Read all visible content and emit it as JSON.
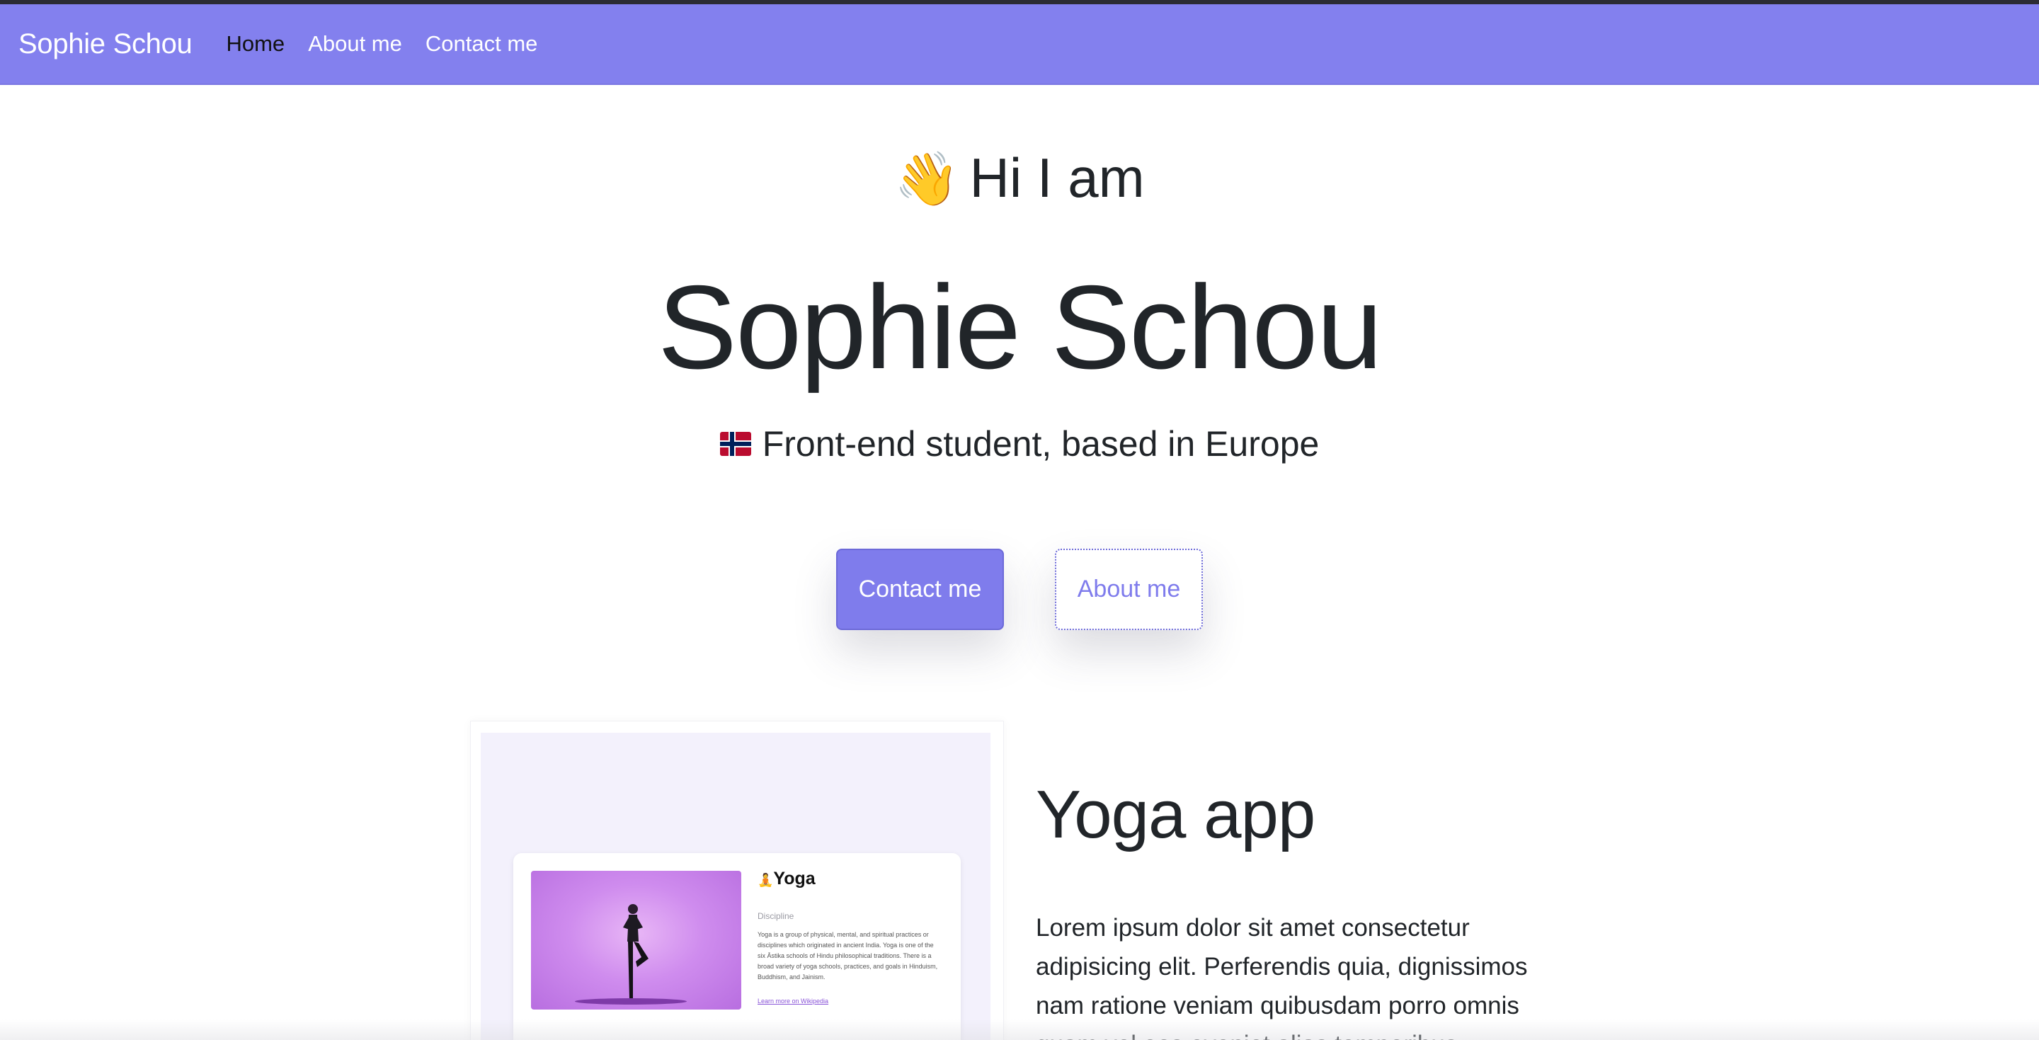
{
  "navbar": {
    "brand": "Sophie Schou",
    "links": [
      {
        "label": "Home",
        "active": true
      },
      {
        "label": "About me",
        "active": false
      },
      {
        "label": "Contact me",
        "active": false
      }
    ],
    "color": "#8380ee"
  },
  "hero": {
    "greeting_emoji": "👋",
    "greeting": "Hi I am",
    "name": "Sophie Schou",
    "flag_icon": "norway-flag-icon",
    "tagline": "Front-end student, based in Europe",
    "primary_button": "Contact me",
    "secondary_button": "About me"
  },
  "project": {
    "title": "Yoga app",
    "description": "Lorem ipsum dolor sit amet consectetur adipisicing elit. Perferendis quia, dignissimos nam ratione veniam quibusdam porro omnis quam vel eos eveniet alias temporibus",
    "preview": {
      "emoji": "🧘",
      "title": "Yoga",
      "subtitle": "Discipline",
      "body": "Yoga is a group of physical, mental, and spiritual practices or disciplines which originated in ancient India. Yoga is one of the six Āstika schools of Hindu philosophical traditions. There is a broad variety of yoga schools, practices, and goals in Hinduism, Buddhism, and Jainism.",
      "link": "Learn more on Wikipedia"
    }
  }
}
